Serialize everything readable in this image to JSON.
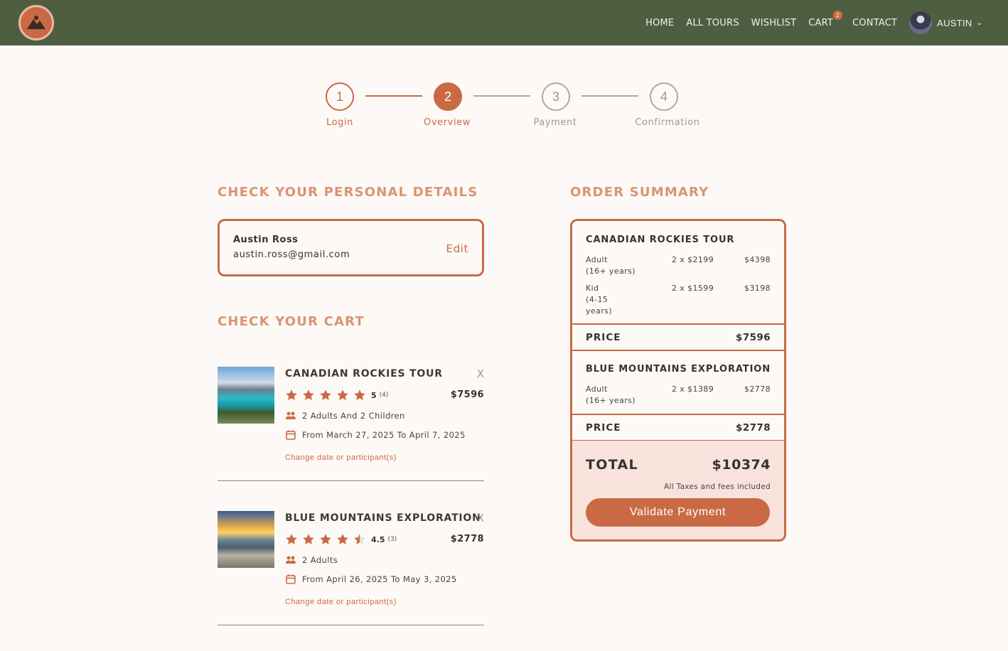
{
  "nav": {
    "links": [
      "HOME",
      "ALL TOURS",
      "WISHLIST",
      "CART",
      "CONTACT"
    ],
    "cart_count": "2",
    "user": "AUSTIN"
  },
  "stepper": [
    {
      "num": "1",
      "label": "Login",
      "state": "done"
    },
    {
      "num": "2",
      "label": "Overview",
      "state": "active"
    },
    {
      "num": "3",
      "label": "Payment",
      "state": "inactive"
    },
    {
      "num": "4",
      "label": "Confirmation",
      "state": "inactive"
    }
  ],
  "personal": {
    "heading": "CHECK YOUR PERSONAL DETAILS",
    "name": "Austin Ross",
    "email": "austin.ross@gmail.com",
    "edit": "Edit"
  },
  "cart": {
    "heading": "CHECK YOUR CART",
    "items": [
      {
        "title": "CANADIAN ROCKIES TOUR",
        "close": "X",
        "rating": "5",
        "rating_value": 5,
        "reviews": "(4)",
        "price": "$7596",
        "participants": "2 Adults And 2 Children",
        "dates": "From March 27, 2025 To April 7, 2025",
        "change": "Change date or participant(s)"
      },
      {
        "title": "BLUE MOUNTAINS EXPLORATION",
        "close": "X",
        "rating": "4.5",
        "rating_value": 4.5,
        "reviews": "(3)",
        "price": "$2778",
        "participants": "2 Adults",
        "dates": "From April 26, 2025 To May 3, 2025",
        "change": "Change date or participant(s)"
      }
    ]
  },
  "summary": {
    "heading": "ORDER SUMMARY",
    "tours": [
      {
        "title": "CANADIAN ROCKIES TOUR",
        "lines": [
          {
            "label_1": "Adult",
            "label_2": "(16+ years)",
            "label_3": "",
            "qty": "2 x $2199",
            "amount": "$4398"
          },
          {
            "label_1": "Kid",
            "label_2": "(4-15",
            "label_3": "years)",
            "qty": "2 x $1599",
            "amount": "$3198"
          }
        ],
        "price_label": "PRICE",
        "price": "$7596"
      },
      {
        "title": "BLUE MOUNTAINS EXPLORATION",
        "lines": [
          {
            "label_1": "Adult",
            "label_2": "(16+ years)",
            "label_3": "",
            "qty": "2 x $1389",
            "amount": "$2778"
          }
        ],
        "price_label": "PRICE",
        "price": "$2778"
      }
    ],
    "total_label": "TOTAL",
    "total": "$10374",
    "note": "All Taxes and fees included",
    "button": "Validate Payment"
  },
  "colors": {
    "nav_bg": "#4e5f41",
    "accent": "#c96a45",
    "heading": "#d99474",
    "total_bg": "#f7e3dc"
  }
}
